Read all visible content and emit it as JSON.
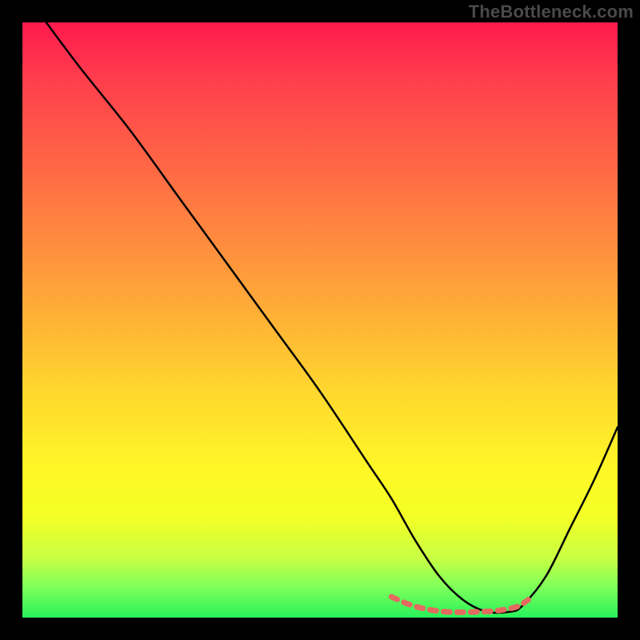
{
  "watermark": "TheBottleneck.com",
  "chart_data": {
    "type": "line",
    "title": "",
    "xlabel": "",
    "ylabel": "",
    "xlim": [
      0,
      100
    ],
    "ylim": [
      0,
      100
    ],
    "series": [
      {
        "name": "main-curve",
        "color": "#000000",
        "x": [
          4,
          10,
          18,
          26,
          34,
          42,
          50,
          58,
          62,
          66,
          70,
          74,
          78,
          82,
          84,
          88,
          92,
          96,
          100
        ],
        "y": [
          100,
          92,
          82,
          71,
          60,
          49,
          38,
          26,
          20,
          13,
          7,
          3,
          1,
          1,
          2,
          7,
          15,
          23,
          32
        ]
      },
      {
        "name": "plateau-highlight",
        "color": "#e46a60",
        "x": [
          62,
          65,
          68,
          71,
          74,
          77,
          80,
          83,
          85
        ],
        "y": [
          3.5,
          2.2,
          1.4,
          1.0,
          0.9,
          1.0,
          1.2,
          1.8,
          3.0
        ]
      }
    ]
  }
}
